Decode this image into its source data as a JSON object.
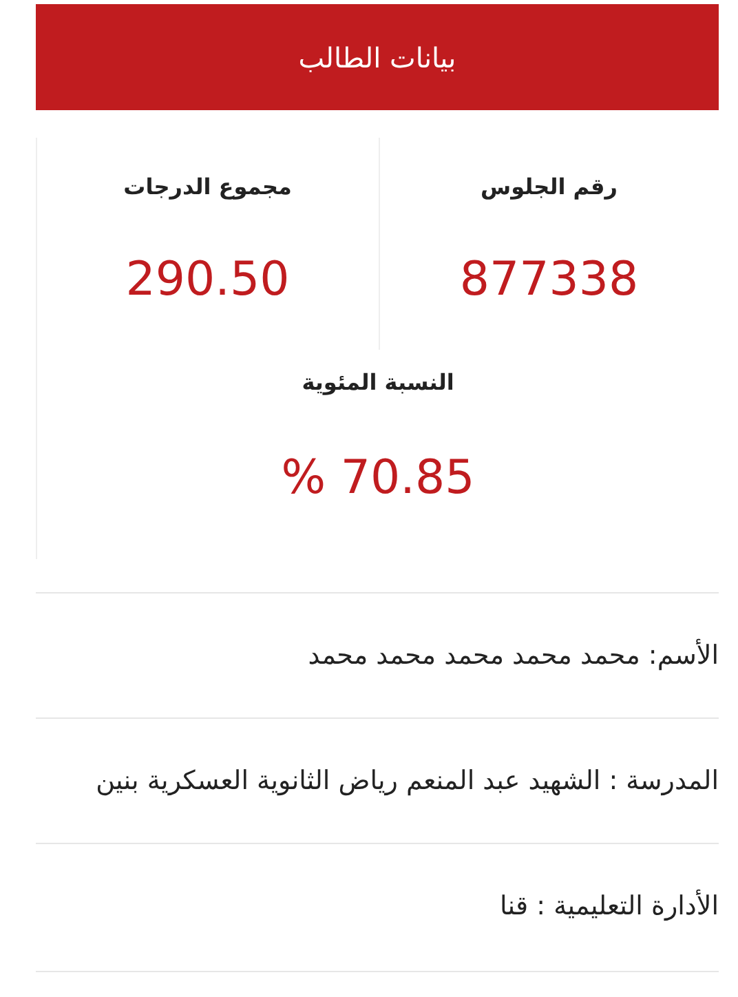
{
  "header": {
    "title": "بيانات الطالب"
  },
  "stats": [
    {
      "label": "رقم الجلوس",
      "value": "877338"
    },
    {
      "label": "مجموع الدرجات",
      "value": "290.50"
    }
  ],
  "percentage": {
    "label": "النسبة المئوية",
    "value": "% 70.85"
  },
  "details": [
    "الأسم: محمد محمد محمد محمد محمد",
    "المدرسة : الشهيد عبد المنعم رياض الثانوية العسكرية بنين",
    "الأدارة التعليمية : قنا"
  ]
}
